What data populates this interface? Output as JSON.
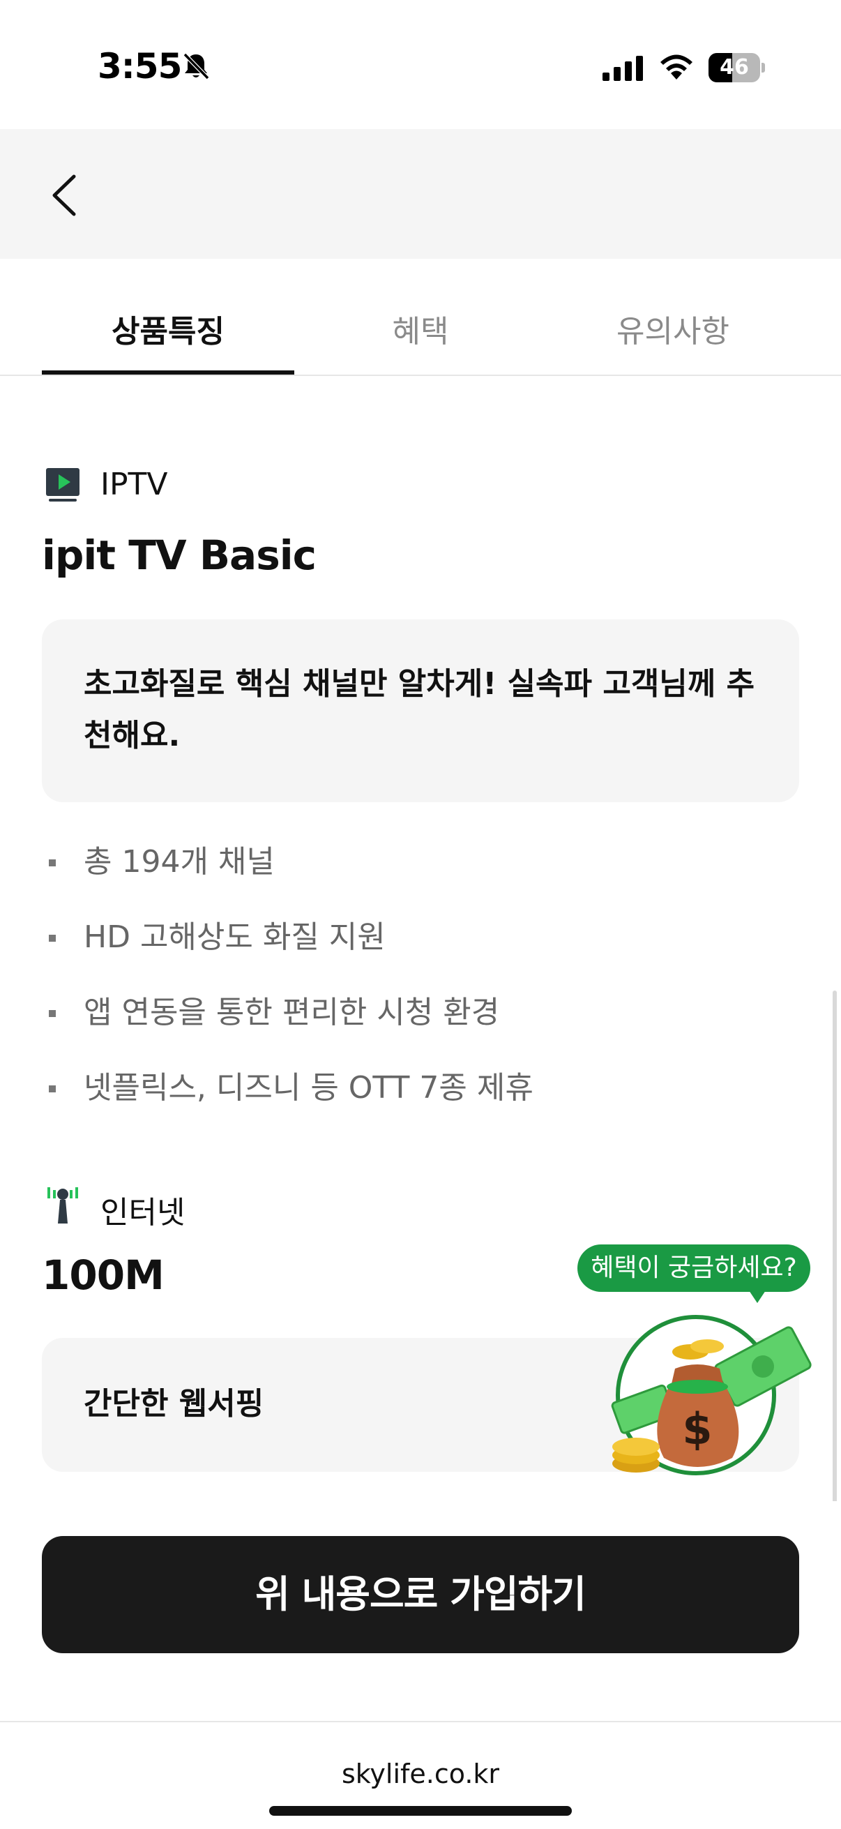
{
  "status_bar": {
    "time": "3:55",
    "battery_level": "46",
    "battery_fraction": 0.46,
    "icons": [
      "bell-slash-icon",
      "cellular-signal-icon",
      "wifi-icon",
      "battery-icon"
    ]
  },
  "header": {
    "back_icon": "chevron-left-icon"
  },
  "tabs": [
    {
      "label": "상품특징",
      "active": true
    },
    {
      "label": "혜택",
      "active": false
    },
    {
      "label": "유의사항",
      "active": false
    }
  ],
  "iptv": {
    "icon": "tv-play-icon",
    "category": "IPTV",
    "product_name": "ipit TV Basic",
    "description": "초고화질로 핵심 채널만 알차게! 실속파 고객님께 추천해요.",
    "features": [
      "총 194개 채널",
      "HD 고해상도 화질 지원",
      "앱 연동을 통한 편리한 시청 환경",
      "넷플릭스, 디즈니 등 OTT 7종 제휴"
    ]
  },
  "internet": {
    "icon": "antenna-icon",
    "category": "인터넷",
    "product_name": "100M",
    "description": "간단한 웹서핑"
  },
  "promo": {
    "bubble_text": "혜택이 궁금하세요?",
    "image_icon": "money-bag-icon"
  },
  "cta": {
    "label": "위 내용으로 가입하기"
  },
  "browser": {
    "url": "skylife.co.kr"
  },
  "colors": {
    "brand_green": "#1a9a44",
    "cta_background": "#1a1a1a",
    "header_background": "#f5f5f5",
    "box_background": "#f5f5f5"
  }
}
